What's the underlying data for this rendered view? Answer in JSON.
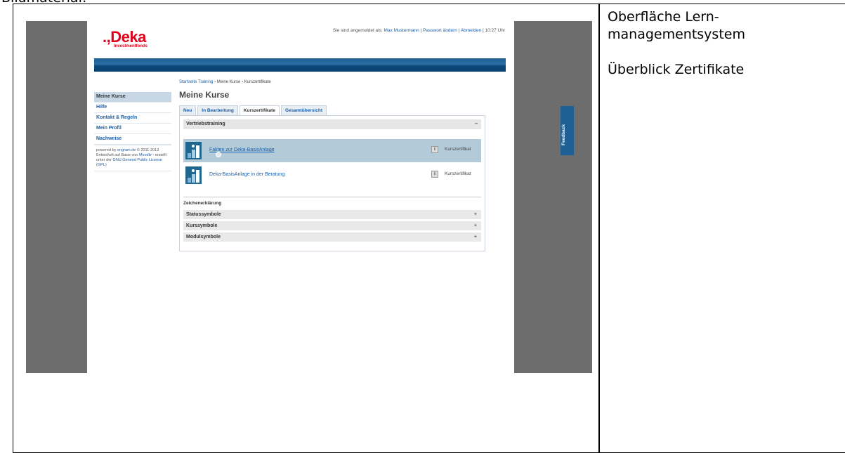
{
  "document": {
    "caption": "Bildmaterial:",
    "side_title": "Oberfläche Lern-managementsystem",
    "side_subtitle": "Überblick Zertifikate"
  },
  "header": {
    "logo": "Deka",
    "logo_sub": "Investmentfonds",
    "login_prefix": "Sie sind angemeldet als:",
    "user": "Max Mustermann",
    "change_password": "Passwort ändern",
    "logout": "Abmelden",
    "time": "10:27 Uhr",
    "sep": "|"
  },
  "breadcrumb": {
    "home": "Startseite Training",
    "sep": "›",
    "mid": "Meine Kurse",
    "current": "Kurszertifikate"
  },
  "sidebar": {
    "items": [
      {
        "label": "Meine Kurse"
      },
      {
        "label": "Hilfe"
      },
      {
        "label": "Kontakt & Regeln"
      },
      {
        "label": "Mein Profil"
      },
      {
        "label": "Nachweise"
      }
    ],
    "footer": {
      "powered_by": "powered by",
      "engram": "engram.de",
      "copyright": "© 2011-2013",
      "developed": "Entwickelt auf Basis von",
      "moodle": "Moodle",
      "license_text": "- erstellt unter der",
      "gpl": "GNU General Public License (GPL)"
    }
  },
  "main": {
    "title": "Meine Kurse",
    "tabs": [
      {
        "label": "Neu"
      },
      {
        "label": "In Bearbeitung"
      },
      {
        "label": "Kurszertifikate"
      },
      {
        "label": "Gesamtübersicht"
      }
    ],
    "group": {
      "title": "Vertriebstraining",
      "toggle": "–"
    },
    "courses": [
      {
        "name": "Fakten zur Deka-BasisAnlage",
        "info": "i",
        "type": "Kurszertifikat"
      },
      {
        "name": "Deka-BasisAnlage in der Beratung",
        "info": "i",
        "type": "Kurszertifikat"
      }
    ],
    "legend": {
      "title": "Zeichenerklärung",
      "rows": [
        {
          "label": "Statussymbole",
          "toggle": "+"
        },
        {
          "label": "Kurssymbole",
          "toggle": "+"
        },
        {
          "label": "Modulsymbole",
          "toggle": "+"
        }
      ]
    }
  },
  "feedback": {
    "label": "Feedback"
  },
  "colors": {
    "brand_red": "#e2001a",
    "banner_blue": "#0e4b7b",
    "link_blue": "#1c5ea8",
    "highlight": "#b3cad9"
  }
}
